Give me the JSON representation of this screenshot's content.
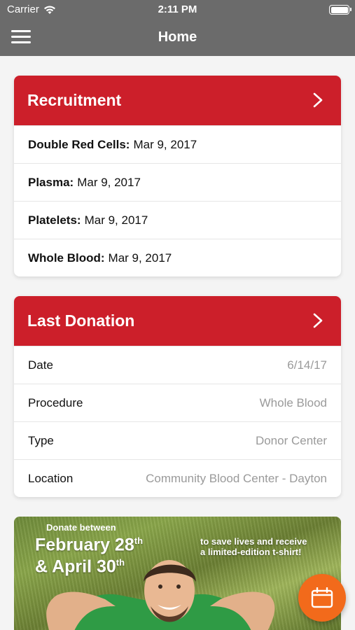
{
  "status_bar": {
    "carrier": "Carrier",
    "time": "2:11 PM"
  },
  "nav": {
    "title": "Home",
    "menu_icon": "hamburger-menu-icon"
  },
  "recruitment": {
    "title": "Recruitment",
    "rows": [
      {
        "label": "Double Red Cells:",
        "value": "Mar 9, 2017"
      },
      {
        "label": "Plasma:",
        "value": "Mar 9, 2017"
      },
      {
        "label": "Platelets:",
        "value": "Mar 9, 2017"
      },
      {
        "label": "Whole Blood:",
        "value": "Mar 9, 2017"
      }
    ]
  },
  "last_donation": {
    "title": "Last Donation",
    "rows": [
      {
        "label": "Date",
        "value": "6/14/17"
      },
      {
        "label": "Procedure",
        "value": "Whole Blood"
      },
      {
        "label": "Type",
        "value": "Donor Center"
      },
      {
        "label": "Location",
        "value": "Community Blood Center - Dayton"
      }
    ]
  },
  "promo": {
    "line1": "Donate between",
    "date1_main": "February 28",
    "date1_sup": "th",
    "date2_main": "& April 30",
    "date2_sup": "th",
    "right_line1": "to save lives and receive",
    "right_line2": "a limited-edition t-shirt!"
  },
  "colors": {
    "header_red": "#cc1f2a",
    "nav_gray": "#6b6b6b",
    "fab_orange": "#f26a1b"
  },
  "fab": {
    "icon": "calendar-icon"
  }
}
